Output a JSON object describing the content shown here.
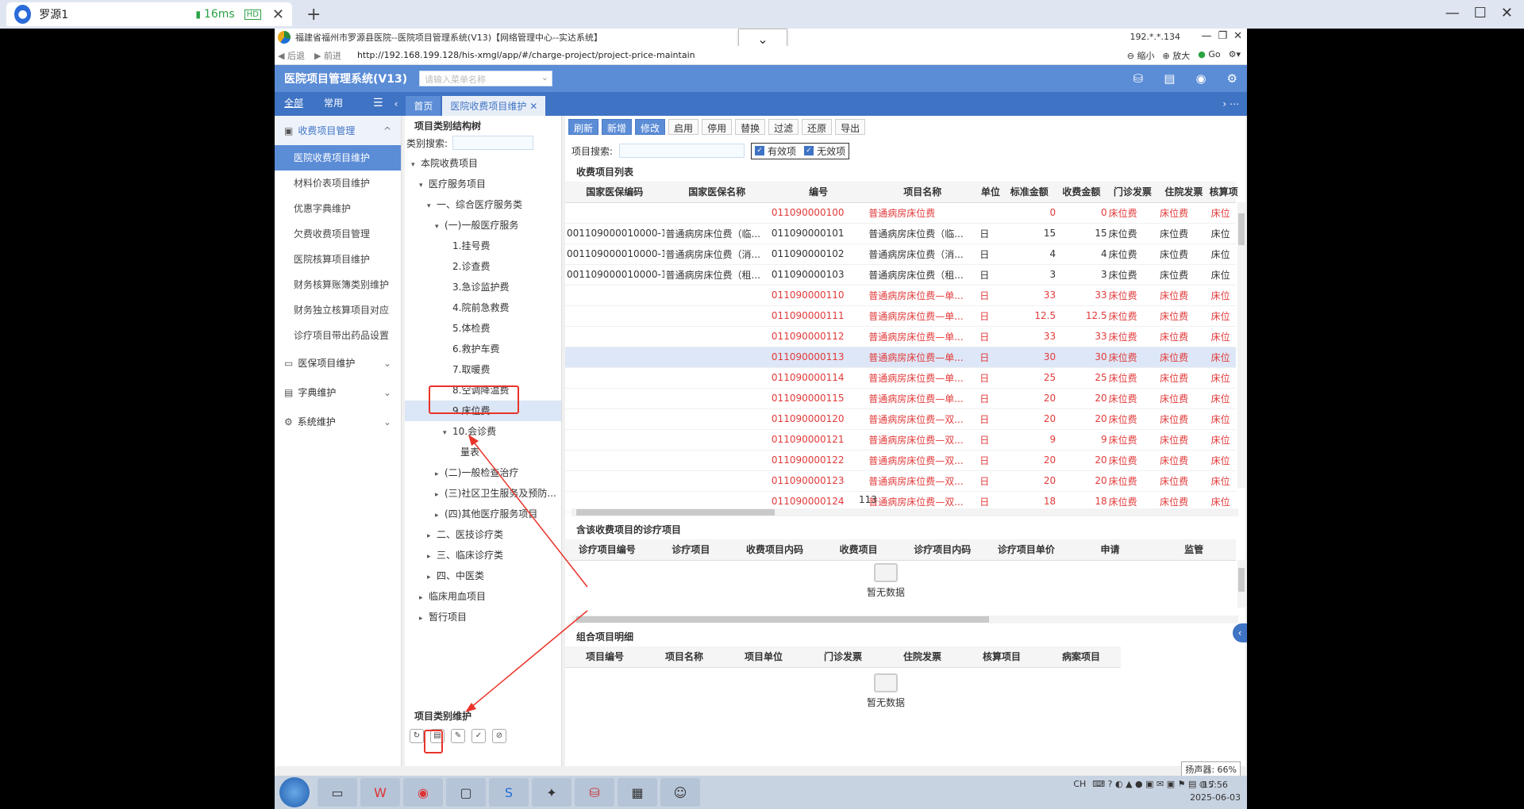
{
  "browser": {
    "tab_title": "罗源1",
    "signal": "16ms",
    "hd": "HD"
  },
  "window": {
    "title": "福建省福州市罗源县医院--医院项目管理系统(V13)【网络管理中心--实达系统】",
    "ip": "192.*.*.134"
  },
  "nav": {
    "back": "后退",
    "forward": "前进",
    "url": "http://192.168.199.128/his-xmgl/app/#/charge-project/project-price-maintain",
    "zoom_out": "缩小",
    "zoom_in": "放大",
    "go": "Go"
  },
  "app": {
    "title": "医院项目管理系统(V13)",
    "search_placeholder": "请输入菜单名称"
  },
  "tabs": {
    "side_all": "全部",
    "side_common": "常用",
    "home": "首页",
    "current": "医院收费项目维护"
  },
  "left_nav": {
    "group1": "收费项目管理",
    "items": [
      "医院收费项目维护",
      "材料价表项目维护",
      "优惠字典维护",
      "欠费收费项目管理",
      "医院核算项目维护",
      "财务核算账簿类别维护",
      "财务独立核算项目对应",
      "诊疗项目带出药品设置"
    ],
    "group2": "医保项目维护",
    "group3": "字典维护",
    "group4": "系统维护"
  },
  "tree": {
    "title": "项目类别结构树",
    "search_label": "类别搜索:",
    "nodes": [
      "本院收费项目",
      "医疗服务项目",
      "一、综合医疗服务类",
      "(一)一般医疗服务",
      "1.挂号费",
      "2.诊查费",
      "3.急诊监护费",
      "4.院前急救费",
      "5.体检费",
      "6.救护车费",
      "7.取暖费",
      "8.空调降温费",
      "9.床位费",
      "10.会诊费",
      "量表",
      "(二)一般检查治疗",
      "(三)社区卫生服务及预防...",
      "(四)其他医疗服务项目",
      "二、医技诊疗类",
      "三、临床诊疗类",
      "四、中医类",
      "临床用血项目",
      "暂行项目"
    ],
    "bottom_title": "项目类别维护"
  },
  "toolbar": {
    "refresh": "刷新",
    "add": "新增",
    "edit": "修改",
    "enable": "启用",
    "disable": "停用",
    "replace": "替换",
    "filter": "过滤",
    "restore": "还原",
    "export": "导出"
  },
  "filter": {
    "label": "项目搜索:",
    "valid": "有效项",
    "invalid": "无效项"
  },
  "list": {
    "title": "收费项目列表",
    "columns": [
      "国家医保编码",
      "国家医保名称",
      "编号",
      "项目名称",
      "单位",
      "标准金额",
      "收费金额",
      "门诊发票",
      "住院发票",
      "核算项"
    ],
    "rows": [
      [
        "",
        "",
        "011090000100",
        "普通病房床位费",
        "",
        "0",
        "0",
        "床位费",
        "床位费",
        "床位"
      ],
      [
        "001109000010000-1...",
        "普通病房床位费（临...",
        "011090000101",
        "普通病房床位费（临...",
        "日",
        "15",
        "15",
        "床位费",
        "床位费",
        "床位"
      ],
      [
        "001109000010000-1...",
        "普通病房床位费（消...",
        "011090000102",
        "普通病房床位费（消...",
        "日",
        "4",
        "4",
        "床位费",
        "床位费",
        "床位"
      ],
      [
        "001109000010000-1...",
        "普通病房床位费（租...",
        "011090000103",
        "普通病房床位费（租...",
        "日",
        "3",
        "3",
        "床位费",
        "床位费",
        "床位"
      ],
      [
        "",
        "",
        "011090000110",
        "普通病房床位费—单...",
        "日",
        "33",
        "33",
        "床位费",
        "床位费",
        "床位"
      ],
      [
        "",
        "",
        "011090000111",
        "普通病房床位费—单...",
        "日",
        "12.5",
        "12.5",
        "床位费",
        "床位费",
        "床位"
      ],
      [
        "",
        "",
        "011090000112",
        "普通病房床位费—单...",
        "日",
        "33",
        "33",
        "床位费",
        "床位费",
        "床位"
      ],
      [
        "",
        "",
        "011090000113",
        "普通病房床位费—单...",
        "日",
        "30",
        "30",
        "床位费",
        "床位费",
        "床位"
      ],
      [
        "",
        "",
        "011090000114",
        "普通病房床位费—单...",
        "日",
        "25",
        "25",
        "床位费",
        "床位费",
        "床位"
      ],
      [
        "",
        "",
        "011090000115",
        "普通病房床位费—单...",
        "日",
        "20",
        "20",
        "床位费",
        "床位费",
        "床位"
      ],
      [
        "",
        "",
        "011090000120",
        "普通病房床位费—双...",
        "日",
        "20",
        "20",
        "床位费",
        "床位费",
        "床位"
      ],
      [
        "",
        "",
        "011090000121",
        "普通病房床位费—双...",
        "日",
        "9",
        "9",
        "床位费",
        "床位费",
        "床位"
      ],
      [
        "",
        "",
        "011090000122",
        "普通病房床位费—双...",
        "日",
        "20",
        "20",
        "床位费",
        "床位费",
        "床位"
      ],
      [
        "",
        "",
        "011090000123",
        "普通病房床位费—双...",
        "日",
        "20",
        "20",
        "床位费",
        "床位费",
        "床位"
      ],
      [
        "",
        "",
        "011090000124",
        "普通病房床位费—双...",
        "日",
        "18",
        "18",
        "床位费",
        "床位费",
        "床位"
      ]
    ],
    "count": "113"
  },
  "diag": {
    "title": "含该收费项目的诊疗项目",
    "columns": [
      "诊疗项目编号",
      "诊疗项目",
      "收费项目内码",
      "收费项目",
      "诊疗项目内码",
      "诊疗项目单价",
      "申请",
      "监管"
    ],
    "empty": "暂无数据"
  },
  "combo": {
    "title": "组合项目明细",
    "columns": [
      "项目编号",
      "项目名称",
      "项目单位",
      "门诊发票",
      "住院发票",
      "核算项目",
      "病案项目"
    ],
    "empty": "暂无数据"
  },
  "taskbar": {
    "lang": "CH",
    "time": "15:56",
    "date": "2025-06-03",
    "volume": "扬声器: 66%"
  },
  "colors": {
    "accent": "#5b8cd6",
    "accent_dark": "#3f73c4",
    "alert_red": "#e23a3a",
    "annotation": "#e8342a"
  }
}
